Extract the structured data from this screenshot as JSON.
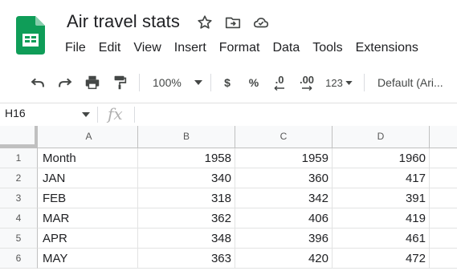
{
  "app": {
    "doc_title": "Air travel stats",
    "icons": [
      "star-icon",
      "move-to-folder-icon",
      "cloud-saved-icon"
    ]
  },
  "menu": [
    "File",
    "Edit",
    "View",
    "Insert",
    "Format",
    "Data",
    "Tools",
    "Extensions"
  ],
  "toolbar": {
    "zoom": "100%",
    "currency": "$",
    "percent": "%",
    "decrease_decimal": ".0",
    "increase_decimal": ".00",
    "number_format": "123",
    "font": "Default (Ari..."
  },
  "formula_bar": {
    "cell_ref": "H16",
    "fx": "fx",
    "value": ""
  },
  "sheet": {
    "columns": [
      "A",
      "B",
      "C",
      "D"
    ],
    "row_numbers": [
      "1",
      "2",
      "3",
      "4",
      "5",
      "6"
    ],
    "rows": [
      [
        "Month",
        "1958",
        "1959",
        "1960"
      ],
      [
        "JAN",
        "340",
        "360",
        "417"
      ],
      [
        "FEB",
        "318",
        "342",
        "391"
      ],
      [
        "MAR",
        "362",
        "406",
        "419"
      ],
      [
        "APR",
        "348",
        "396",
        "461"
      ],
      [
        "MAY",
        "363",
        "420",
        "472"
      ]
    ]
  },
  "colors": {
    "sheets_green": "#0F9D58",
    "header_bg": "#f8f9fa",
    "gridline": "#e2e3e3"
  }
}
